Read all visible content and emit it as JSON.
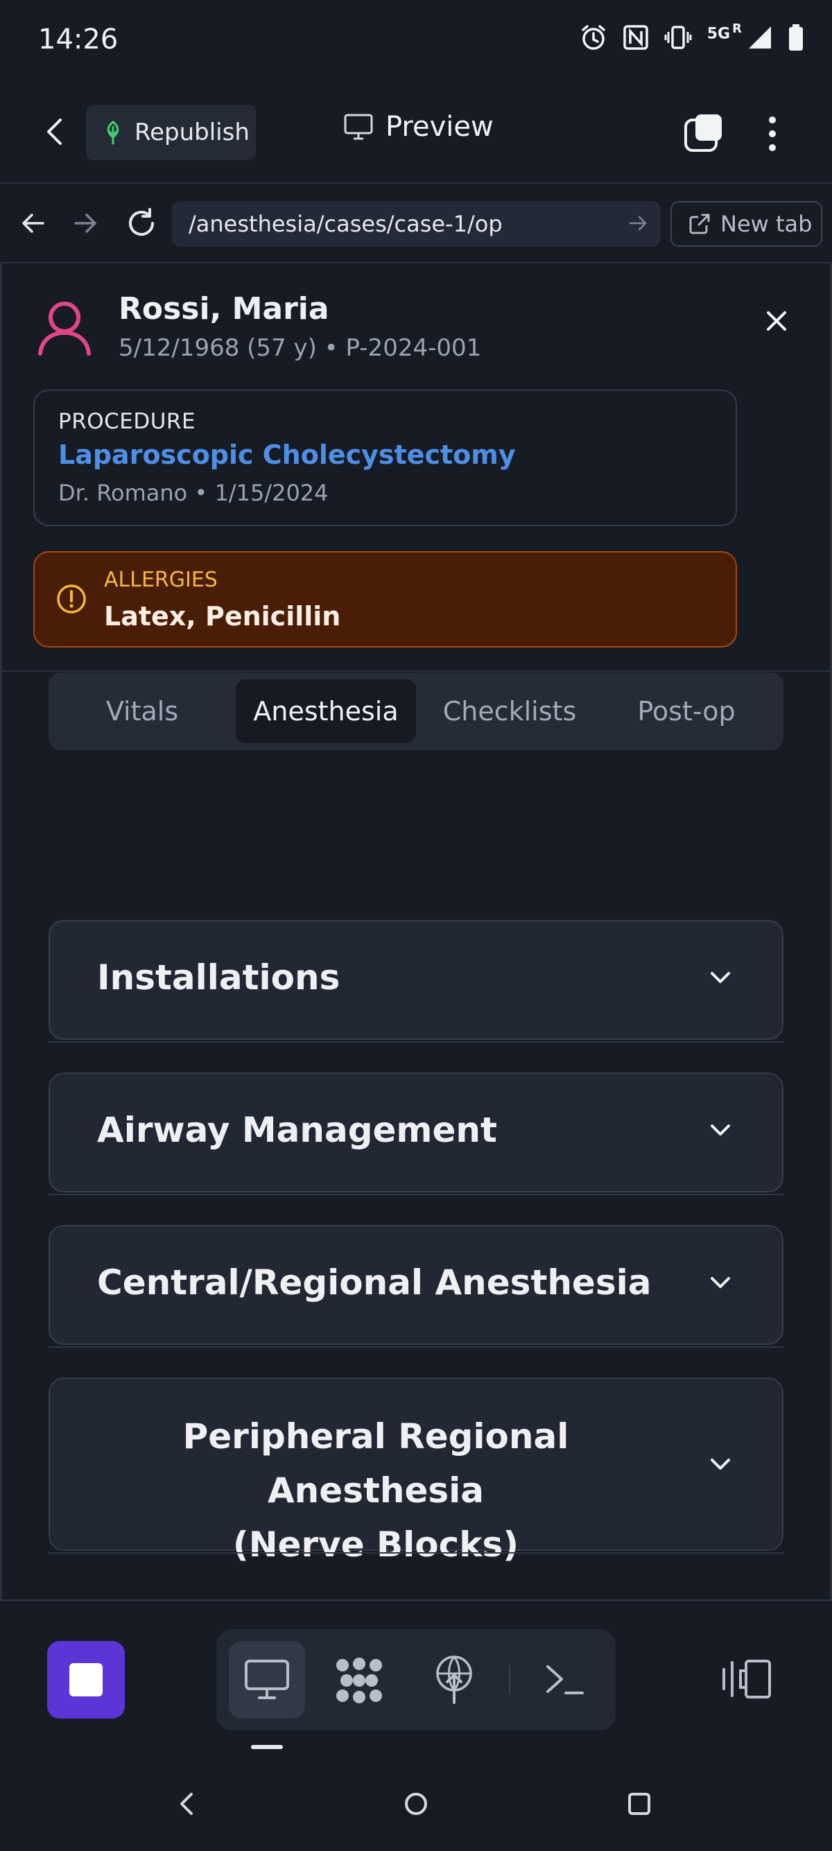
{
  "status_bar": {
    "time": "14:26",
    "network": "5G",
    "roaming": "R",
    "icons": [
      "alarm-icon",
      "nfc-icon",
      "vibrate-icon",
      "signal-icon",
      "battery-icon"
    ]
  },
  "app_header": {
    "republish_label": "Republish",
    "preview_label": "Preview",
    "icons": [
      "back-arrow-icon",
      "leaf-icon",
      "monitor-icon",
      "tabs-icon",
      "more-vertical-icon"
    ]
  },
  "browser": {
    "url": "/anesthesia/cases/case-1/op",
    "new_tab_label": "New tab",
    "icons": [
      "nav-back-icon",
      "nav-forward-icon",
      "reload-icon",
      "go-arrow-icon",
      "external-link-icon"
    ]
  },
  "patient": {
    "name": "Rossi, Maria",
    "meta": "5/12/1968 (57 y) • P-2024-001"
  },
  "procedure": {
    "label": "PROCEDURE",
    "name": "Laparoscopic Cholecystectomy",
    "meta": "Dr. Romano • 1/15/2024"
  },
  "allergies": {
    "label": "ALLERGIES",
    "value": "Latex, Penicillin"
  },
  "tabs": [
    {
      "label": "Vitals",
      "active": false
    },
    {
      "label": "Anesthesia",
      "active": true
    },
    {
      "label": "Checklists",
      "active": false
    },
    {
      "label": "Post-op",
      "active": false
    }
  ],
  "sections": [
    {
      "title": "Installations"
    },
    {
      "title": "Airway Management"
    },
    {
      "title": "Central/Regional Anesthesia"
    },
    {
      "title_line1": "Peripheral Regional Anesthesia",
      "title_line2": "(Nerve Blocks)"
    }
  ],
  "dock": {
    "icons": [
      "stop-icon",
      "desktop-icon",
      "apps-icon",
      "deploy-icon",
      "terminal-icon",
      "split-view-icon"
    ]
  },
  "colors": {
    "background": "#171b24",
    "accent_purple": "#5b35d5",
    "procedure_blue": "#4e8fe6",
    "allergy_bg": "#4a1d06",
    "allergy_text": "#f6b93b",
    "avatar_pink": "#e0458a"
  }
}
